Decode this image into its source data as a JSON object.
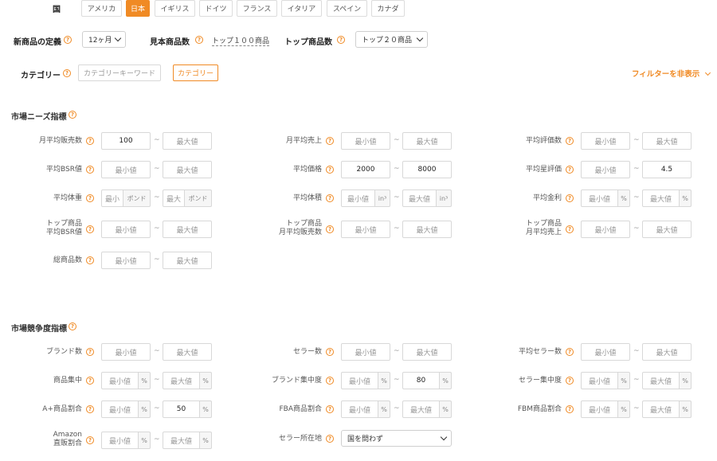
{
  "country": {
    "label": "国",
    "options": [
      "アメリカ",
      "日本",
      "イギリス",
      "ドイツ",
      "フランス",
      "イタリア",
      "スペイン",
      "カナダ"
    ],
    "selected": "日本"
  },
  "settings": {
    "new_product_label": "新商品の定義",
    "new_product_value": "12ヶ月",
    "sample_count_label": "見本商品数",
    "sample_count_value": "トップ１００商品",
    "top_count_label": "トップ商品数",
    "top_count_value": "トップ２０商品"
  },
  "category": {
    "label": "カテゴリー",
    "keyword_placeholder": "カテゴリーキーワード",
    "button_label": "カテゴリー"
  },
  "filter_toggle_label": "フィルターを非表示",
  "market_needs": {
    "title": "市場ニーズ指標",
    "min_placeholder": "最小値",
    "max_placeholder": "最大値",
    "monthly_sales": {
      "label": "月平均販売数",
      "min": "100"
    },
    "monthly_revenue": {
      "label": "月平均売上"
    },
    "avg_reviews": {
      "label": "平均評価数"
    },
    "avg_bsr": {
      "label": "平均BSR値"
    },
    "avg_price": {
      "label": "平均価格",
      "min": "2000",
      "max": "8000"
    },
    "avg_rating": {
      "label": "平均星評価",
      "max": "4.5"
    },
    "avg_weight": {
      "label": "平均体重",
      "min_ph": "最小",
      "max_ph": "最大",
      "unit": "ポンド"
    },
    "avg_volume": {
      "label": "平均体積",
      "unit": "in³"
    },
    "avg_profit": {
      "label": "平均金利",
      "unit": "%"
    },
    "top_bsr": {
      "label_line1": "トップ商品",
      "label_line2": "平均BSR値"
    },
    "top_monthly_sales": {
      "label_line1": "トップ商品",
      "label_line2": "月平均販売数"
    },
    "top_monthly_revenue": {
      "label_line1": "トップ商品",
      "label_line2": "月平均売上"
    },
    "total_products": {
      "label": "総商品数"
    }
  },
  "competition": {
    "title": "市場競争度指標",
    "min_placeholder": "最小値",
    "max_placeholder": "最大値",
    "brand_count": {
      "label": "ブランド数"
    },
    "seller_count": {
      "label": "セラー数"
    },
    "avg_sellers": {
      "label": "平均セラー数"
    },
    "product_concentration": {
      "label": "商品集中",
      "unit": "%"
    },
    "brand_concentration": {
      "label": "ブランド集中度",
      "unit": "%",
      "max": "80"
    },
    "seller_concentration": {
      "label": "セラー集中度",
      "unit": "%"
    },
    "aplus_ratio": {
      "label": "A+商品割合",
      "unit": "%",
      "max": "50"
    },
    "fba_ratio": {
      "label": "FBA商品割合",
      "unit": "%"
    },
    "fbm_ratio": {
      "label": "FBM商品割合",
      "unit": "%"
    },
    "amazon_direct": {
      "label_line1": "Amazon",
      "label_line2": "直販割合",
      "unit": "%"
    },
    "seller_location": {
      "label": "セラー所在地",
      "value": "国を問わず"
    }
  },
  "colors": {
    "accent": "#f08a24"
  },
  "icons": {
    "help": "question-circle-icon",
    "toggle": "chevron-down-icon"
  }
}
